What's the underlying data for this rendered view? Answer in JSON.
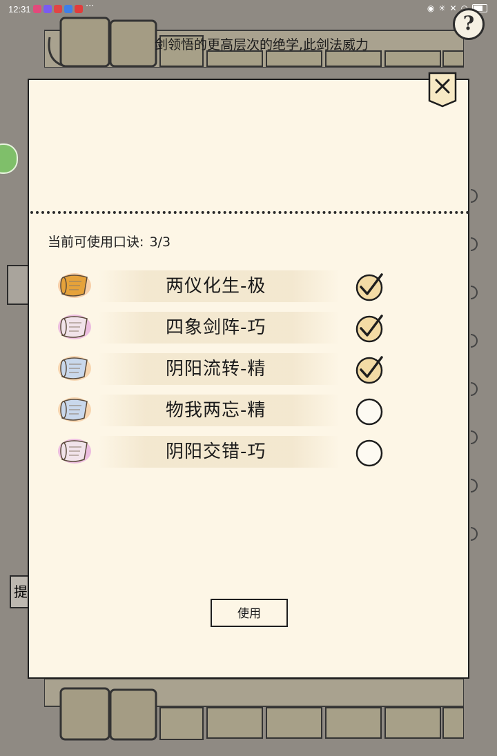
{
  "status_bar": {
    "time": "12:31",
    "overflow": "···"
  },
  "background": {
    "description_text": "剑领悟的更高层次的绝学,此剑法威力",
    "help_label": "?",
    "tip_label": "提"
  },
  "dialog": {
    "count_label": "当前可使用口诀:",
    "count_value": "3/3",
    "items": [
      {
        "label": "两仪化生-极",
        "checked": true,
        "scroll_color": "#e6a23a",
        "glow": "#f0a060"
      },
      {
        "label": "四象剑阵-巧",
        "checked": true,
        "scroll_color": "#f1e3ea",
        "glow": "#d67ad6"
      },
      {
        "label": "阴阳流转-精",
        "checked": true,
        "scroll_color": "#c9d8ec",
        "glow": "#f0b070"
      },
      {
        "label": "物我两忘-精",
        "checked": false,
        "scroll_color": "#c9d8ec",
        "glow": "#f0b070"
      },
      {
        "label": "阴阳交错-巧",
        "checked": false,
        "scroll_color": "#f1e3ea",
        "glow": "#d67ad6"
      }
    ],
    "use_button": "使用"
  },
  "colors": {
    "dialog_bg": "#fdf6e6",
    "overlay": "#8f8a83",
    "check_fill": "#f3dba5",
    "ink": "#1e1e1e"
  }
}
